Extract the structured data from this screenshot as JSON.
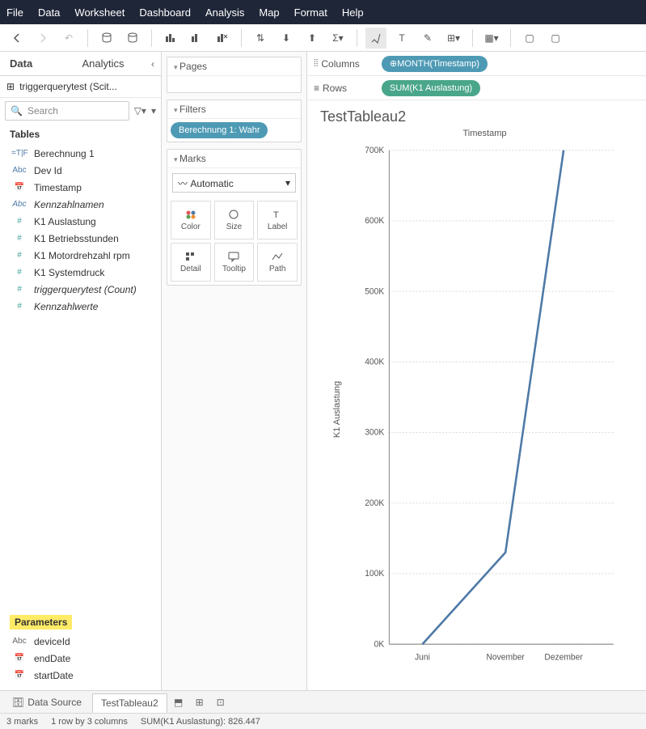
{
  "menu": [
    "File",
    "Data",
    "Worksheet",
    "Dashboard",
    "Analysis",
    "Map",
    "Format",
    "Help"
  ],
  "sidebar": {
    "tabs": {
      "data": "Data",
      "analytics": "Analytics"
    },
    "datasource": "triggerquerytest (Scit...",
    "search_placeholder": "Search",
    "tables_header": "Tables",
    "fields": [
      {
        "ico": "=T|F",
        "cls": "blue",
        "label": "Berechnung 1"
      },
      {
        "ico": "Abc",
        "cls": "blue",
        "label": "Dev Id"
      },
      {
        "ico": "📅",
        "cls": "blue",
        "label": "Timestamp"
      },
      {
        "ico": "Abc",
        "cls": "blue",
        "label": "Kennzahlnamen",
        "italic": true
      },
      {
        "ico": "#",
        "cls": "teal",
        "label": "K1 Auslastung"
      },
      {
        "ico": "#",
        "cls": "teal",
        "label": "K1 Betriebsstunden"
      },
      {
        "ico": "#",
        "cls": "teal",
        "label": "K1 Motordrehzahl rpm"
      },
      {
        "ico": "#",
        "cls": "teal",
        "label": "K1 Systemdruck"
      },
      {
        "ico": "#",
        "cls": "teal",
        "label": "triggerquerytest (Count)",
        "italic": true
      },
      {
        "ico": "#",
        "cls": "teal",
        "label": "Kennzahlwerte",
        "italic": true
      }
    ],
    "parameters_header": "Parameters",
    "parameters": [
      {
        "ico": "Abc",
        "label": "deviceId"
      },
      {
        "ico": "📅",
        "label": "endDate"
      },
      {
        "ico": "📅",
        "label": "startDate"
      }
    ]
  },
  "shelves": {
    "pages": "Pages",
    "filters": "Filters",
    "filter_pill": "Berechnung 1: Wahr",
    "marks": "Marks",
    "marks_type": "Automatic",
    "mark_cells": [
      "Color",
      "Size",
      "Label",
      "Detail",
      "Tooltip",
      "Path"
    ]
  },
  "columns_label": "Columns",
  "rows_label": "Rows",
  "columns_pill": "MONTH(Timestamp)",
  "rows_pill": "SUM(K1 Auslastung)",
  "ws_title": "TestTableau2",
  "chart_data": {
    "type": "line",
    "title": "Timestamp",
    "ylabel": "K1 Auslastung",
    "categories": [
      "Juni",
      "November",
      "Dezember"
    ],
    "values": [
      0,
      130000,
      700000
    ],
    "ylim": [
      0,
      700000
    ],
    "yticks": [
      "0K",
      "100K",
      "200K",
      "300K",
      "400K",
      "500K",
      "600K",
      "700K"
    ]
  },
  "bottom": {
    "datasource": "Data Source",
    "sheet": "TestTableau2"
  },
  "status": {
    "marks": "3 marks",
    "dims": "1 row by 3 columns",
    "sum": "SUM(K1 Auslastung): 826.447"
  }
}
